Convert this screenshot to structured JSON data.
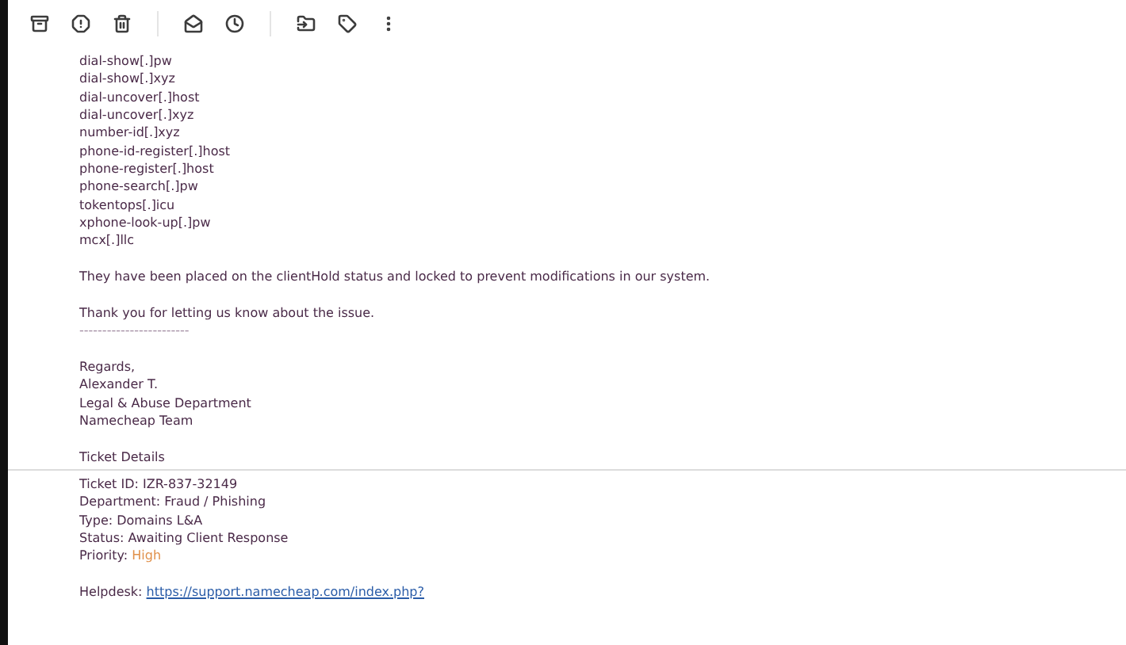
{
  "domains": [
    "dial-show[.]pw",
    "dial-show[.]xyz",
    "dial-uncover[.]host",
    "dial-uncover[.]xyz",
    "number-id[.]xyz",
    "phone-id-register[.]host",
    "phone-register[.]host",
    "phone-search[.]pw",
    "tokentops[.]icu",
    "xphone-look-up[.]pw",
    "mcx[.]llc"
  ],
  "status_sentence": "They have been placed on the clientHold status and locked to prevent modifications in our system.",
  "thanks": "Thank you for letting us know about the issue.",
  "separator": "------------------------",
  "signature": [
    "Regards,",
    "Alexander T.",
    "Legal & Abuse Department",
    "Namecheap Team"
  ],
  "ticket_details": {
    "heading": "Ticket Details",
    "fields": [
      {
        "label": "Ticket ID:",
        "value": "IZR-837-32149"
      },
      {
        "label": "Department:",
        "value": "Fraud / Phishing"
      },
      {
        "label": "Type:",
        "value": "Domains L&A"
      },
      {
        "label": "Status:",
        "value": "Awaiting Client Response"
      },
      {
        "label": "Priority:",
        "value": "High",
        "color": "#e0904a"
      }
    ]
  },
  "helpdesk": {
    "label": "Helpdesk:",
    "link": "https://support.namecheap.com/index.php?"
  }
}
